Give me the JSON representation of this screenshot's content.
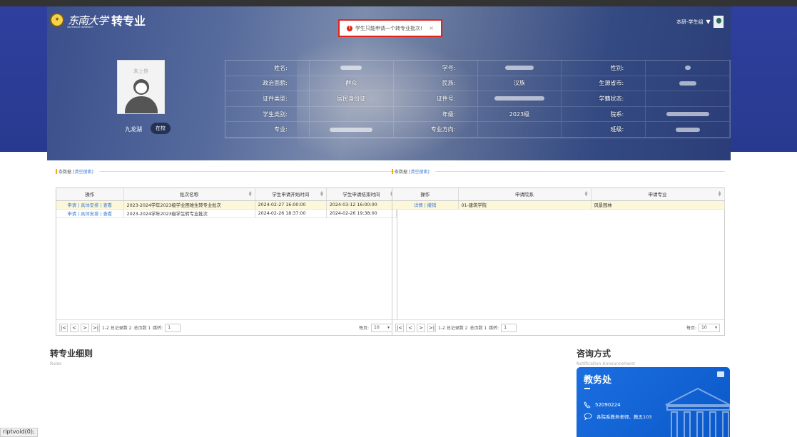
{
  "app": {
    "university": "东南大学",
    "university_sub": "SOUTHEAST UNIVERSITY",
    "system_title": "转专业",
    "user_role": "本研-学生组"
  },
  "toast": {
    "message": "学生只能申请一个转专业批次!",
    "close": "×"
  },
  "profile": {
    "photo_placeholder": "未上传",
    "campus": "九龙湖",
    "status": "在校"
  },
  "info": {
    "name_label": "姓名:",
    "name_value": "",
    "studentno_label": "学号:",
    "studentno_value": "",
    "gender_label": "性别:",
    "gender_value": "",
    "politics_label": "政治面貌:",
    "politics_value": "群众",
    "ethnicity_label": "民族:",
    "ethnicity_value": "汉族",
    "origin_label": "生源省市:",
    "origin_value": "",
    "idtype_label": "证件类型:",
    "idtype_value": "居民身份证",
    "idno_label": "证件号:",
    "idno_value": "",
    "rollstatus_label": "学籍状态:",
    "rollstatus_value": "",
    "category_label": "学生类别:",
    "category_value": "",
    "grade_label": "年级:",
    "grade_value": "2023级",
    "dept_label": "院系:",
    "dept_value": "",
    "major_label": "专业:",
    "major_value": "",
    "direction_label": "专业方向:",
    "direction_value": "",
    "class_label": "班级:",
    "class_value": ""
  },
  "left_panel": {
    "title": "条数据",
    "clear": "[清空搜索]",
    "columns": [
      "操作",
      "批次名称",
      "学生申请开始时间",
      "学生申请结束时间"
    ],
    "rows": [
      {
        "ops": "申请 | 具体安排 | 查看",
        "name": "2023-2024学年2023级学业困难生转专业批次",
        "start": "2024-02-27 16:00:00",
        "end": "2024-03-12 16:00:00"
      },
      {
        "ops": "申请 | 具体安排 | 查看",
        "name": "2023-2024学年2023级学生转专业批次",
        "start": "2024-02-26 18:37:00",
        "end": "2024-02-26 19:38:00"
      }
    ],
    "pager": {
      "first": "|<",
      "prev": "<",
      "next": ">",
      "last": ">|",
      "info": "1-2 总记录数 2",
      "pages": "总页数 1",
      "jump_label": "跳转:",
      "jump_value": "1",
      "per_label": "每页:",
      "per_value": "10"
    }
  },
  "right_panel": {
    "title": "条数据",
    "clear": "[清空搜索]",
    "columns": [
      "操作",
      "申请院系",
      "申请专业"
    ],
    "rows": [
      {
        "ops": "详情 | 撤销",
        "dept": "01-建筑学院",
        "major": "风景园林"
      }
    ],
    "pager": {
      "first": "|<",
      "prev": "<",
      "next": ">",
      "last": ">|",
      "info": "1-2 总记录数 2",
      "pages": "总页数 1",
      "jump_label": "跳转:",
      "jump_value": "1",
      "per_label": "每页:",
      "per_value": "10"
    }
  },
  "rules": {
    "title": "转专业细则",
    "subtitle": "Rules"
  },
  "consult": {
    "title": "咨询方式",
    "subtitle": "Notification Announcement",
    "card_title": "教务处",
    "phone": "52090224",
    "address": "各院系教务老师、教五103"
  },
  "statusbar": {
    "url": "riptvoid(0);"
  }
}
